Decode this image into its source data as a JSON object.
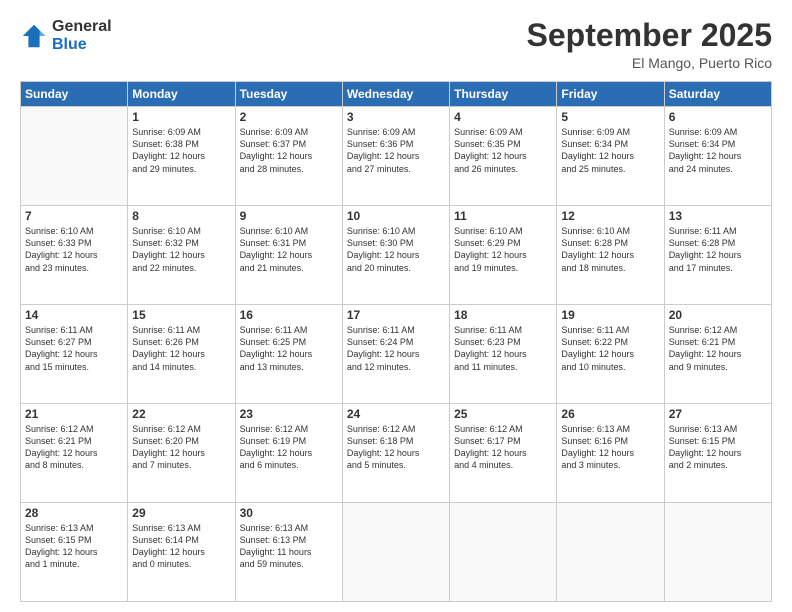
{
  "logo": {
    "general": "General",
    "blue": "Blue"
  },
  "header": {
    "month": "September 2025",
    "location": "El Mango, Puerto Rico"
  },
  "weekdays": [
    "Sunday",
    "Monday",
    "Tuesday",
    "Wednesday",
    "Thursday",
    "Friday",
    "Saturday"
  ],
  "weeks": [
    [
      {
        "day": "",
        "info": ""
      },
      {
        "day": "1",
        "info": "Sunrise: 6:09 AM\nSunset: 6:38 PM\nDaylight: 12 hours\nand 29 minutes."
      },
      {
        "day": "2",
        "info": "Sunrise: 6:09 AM\nSunset: 6:37 PM\nDaylight: 12 hours\nand 28 minutes."
      },
      {
        "day": "3",
        "info": "Sunrise: 6:09 AM\nSunset: 6:36 PM\nDaylight: 12 hours\nand 27 minutes."
      },
      {
        "day": "4",
        "info": "Sunrise: 6:09 AM\nSunset: 6:35 PM\nDaylight: 12 hours\nand 26 minutes."
      },
      {
        "day": "5",
        "info": "Sunrise: 6:09 AM\nSunset: 6:34 PM\nDaylight: 12 hours\nand 25 minutes."
      },
      {
        "day": "6",
        "info": "Sunrise: 6:09 AM\nSunset: 6:34 PM\nDaylight: 12 hours\nand 24 minutes."
      }
    ],
    [
      {
        "day": "7",
        "info": "Sunrise: 6:10 AM\nSunset: 6:33 PM\nDaylight: 12 hours\nand 23 minutes."
      },
      {
        "day": "8",
        "info": "Sunrise: 6:10 AM\nSunset: 6:32 PM\nDaylight: 12 hours\nand 22 minutes."
      },
      {
        "day": "9",
        "info": "Sunrise: 6:10 AM\nSunset: 6:31 PM\nDaylight: 12 hours\nand 21 minutes."
      },
      {
        "day": "10",
        "info": "Sunrise: 6:10 AM\nSunset: 6:30 PM\nDaylight: 12 hours\nand 20 minutes."
      },
      {
        "day": "11",
        "info": "Sunrise: 6:10 AM\nSunset: 6:29 PM\nDaylight: 12 hours\nand 19 minutes."
      },
      {
        "day": "12",
        "info": "Sunrise: 6:10 AM\nSunset: 6:28 PM\nDaylight: 12 hours\nand 18 minutes."
      },
      {
        "day": "13",
        "info": "Sunrise: 6:11 AM\nSunset: 6:28 PM\nDaylight: 12 hours\nand 17 minutes."
      }
    ],
    [
      {
        "day": "14",
        "info": "Sunrise: 6:11 AM\nSunset: 6:27 PM\nDaylight: 12 hours\nand 15 minutes."
      },
      {
        "day": "15",
        "info": "Sunrise: 6:11 AM\nSunset: 6:26 PM\nDaylight: 12 hours\nand 14 minutes."
      },
      {
        "day": "16",
        "info": "Sunrise: 6:11 AM\nSunset: 6:25 PM\nDaylight: 12 hours\nand 13 minutes."
      },
      {
        "day": "17",
        "info": "Sunrise: 6:11 AM\nSunset: 6:24 PM\nDaylight: 12 hours\nand 12 minutes."
      },
      {
        "day": "18",
        "info": "Sunrise: 6:11 AM\nSunset: 6:23 PM\nDaylight: 12 hours\nand 11 minutes."
      },
      {
        "day": "19",
        "info": "Sunrise: 6:11 AM\nSunset: 6:22 PM\nDaylight: 12 hours\nand 10 minutes."
      },
      {
        "day": "20",
        "info": "Sunrise: 6:12 AM\nSunset: 6:21 PM\nDaylight: 12 hours\nand 9 minutes."
      }
    ],
    [
      {
        "day": "21",
        "info": "Sunrise: 6:12 AM\nSunset: 6:21 PM\nDaylight: 12 hours\nand 8 minutes."
      },
      {
        "day": "22",
        "info": "Sunrise: 6:12 AM\nSunset: 6:20 PM\nDaylight: 12 hours\nand 7 minutes."
      },
      {
        "day": "23",
        "info": "Sunrise: 6:12 AM\nSunset: 6:19 PM\nDaylight: 12 hours\nand 6 minutes."
      },
      {
        "day": "24",
        "info": "Sunrise: 6:12 AM\nSunset: 6:18 PM\nDaylight: 12 hours\nand 5 minutes."
      },
      {
        "day": "25",
        "info": "Sunrise: 6:12 AM\nSunset: 6:17 PM\nDaylight: 12 hours\nand 4 minutes."
      },
      {
        "day": "26",
        "info": "Sunrise: 6:13 AM\nSunset: 6:16 PM\nDaylight: 12 hours\nand 3 minutes."
      },
      {
        "day": "27",
        "info": "Sunrise: 6:13 AM\nSunset: 6:15 PM\nDaylight: 12 hours\nand 2 minutes."
      }
    ],
    [
      {
        "day": "28",
        "info": "Sunrise: 6:13 AM\nSunset: 6:15 PM\nDaylight: 12 hours\nand 1 minute."
      },
      {
        "day": "29",
        "info": "Sunrise: 6:13 AM\nSunset: 6:14 PM\nDaylight: 12 hours\nand 0 minutes."
      },
      {
        "day": "30",
        "info": "Sunrise: 6:13 AM\nSunset: 6:13 PM\nDaylight: 11 hours\nand 59 minutes."
      },
      {
        "day": "",
        "info": ""
      },
      {
        "day": "",
        "info": ""
      },
      {
        "day": "",
        "info": ""
      },
      {
        "day": "",
        "info": ""
      }
    ]
  ]
}
